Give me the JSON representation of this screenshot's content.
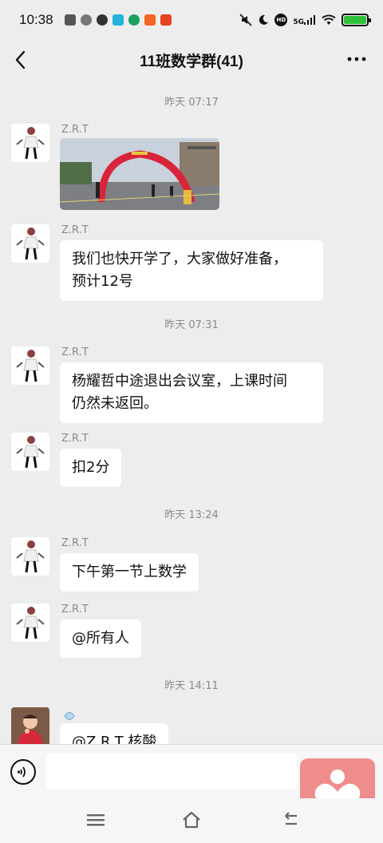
{
  "status_bar": {
    "time": "10:38",
    "signal_label": "5G",
    "hd_label": "HD",
    "battery_level": 1.0
  },
  "header": {
    "title": "11班数学群(41)"
  },
  "messages": [
    {
      "type": "timestamp",
      "text": "昨天 07:17"
    },
    {
      "type": "image",
      "sender": "Z.R.T"
    },
    {
      "type": "text",
      "sender": "Z.R.T",
      "lines": [
        "我们也快开学了，大家做好准备，",
        "预计12号"
      ]
    },
    {
      "type": "timestamp",
      "text": "昨天 07:31"
    },
    {
      "type": "text",
      "sender": "Z.R.T",
      "lines": [
        "杨耀哲中途退出会议室，上课时间",
        "仍然未返回。"
      ]
    },
    {
      "type": "text",
      "sender": "Z.R.T",
      "lines": [
        "扣2分"
      ]
    },
    {
      "type": "timestamp",
      "text": "昨天 13:24"
    },
    {
      "type": "text",
      "sender": "Z.R.T",
      "lines": [
        "下午第一节上数学"
      ]
    },
    {
      "type": "text",
      "sender": "Z.R.T",
      "lines": [
        "@所有人"
      ]
    },
    {
      "type": "timestamp",
      "text": "昨天 14:11"
    },
    {
      "type": "text",
      "sender": "",
      "lines": [
        "@Z.R.T  核酸"
      ]
    }
  ],
  "colors": {
    "background": "#ededed",
    "bubble": "#ffffff",
    "battery": "#2fbf3a",
    "floating_app": "#ee8d8c"
  },
  "icons": [
    "back-icon",
    "more-icon",
    "voice-icon",
    "menu-icon",
    "home-icon",
    "back-nav-icon",
    "heart-app-icon"
  ]
}
